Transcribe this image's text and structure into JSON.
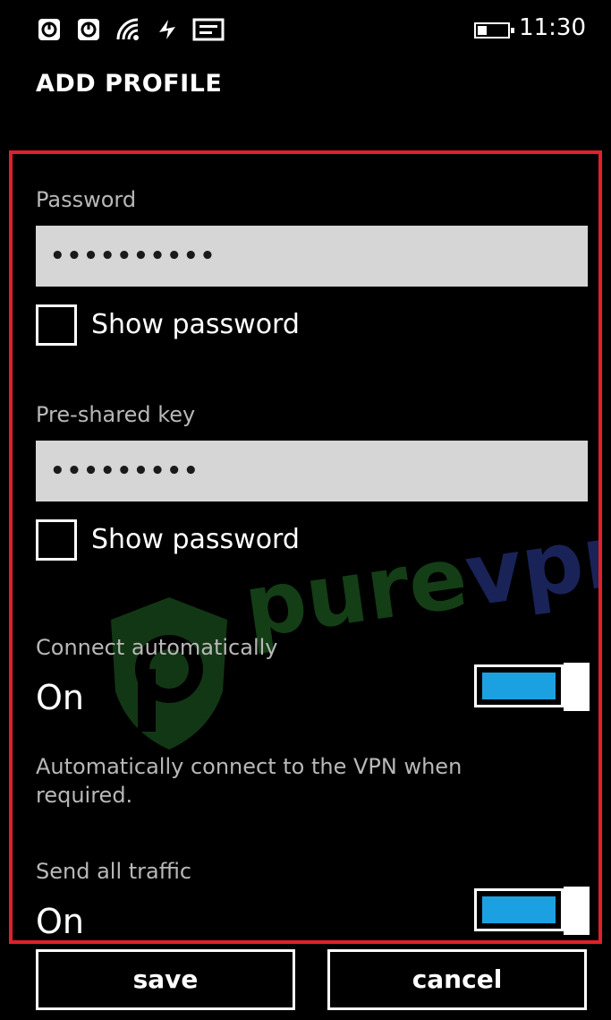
{
  "status_bar": {
    "time": "11:30",
    "icons": [
      "sim-1-icon",
      "sim-2-icon",
      "signal-icon",
      "data-icon",
      "message-icon",
      "battery-icon"
    ]
  },
  "header": {
    "title": "ADD PROFILE"
  },
  "form": {
    "password": {
      "label": "Password",
      "value": "••••••••••"
    },
    "password_show": {
      "label": "Show password",
      "checked": false
    },
    "psk": {
      "label": "Pre-shared key",
      "value": "•••••••••"
    },
    "psk_show": {
      "label": "Show password",
      "checked": false
    },
    "connect_auto": {
      "label": "Connect automatically",
      "state": "On",
      "description": "Automatically connect to the VPN when required."
    },
    "send_all": {
      "label": "Send all traffic",
      "state": "On"
    }
  },
  "watermark": {
    "pure": "pure",
    "vpn": "vpn"
  },
  "app_bar": {
    "save_label": "save",
    "cancel_label": "cancel"
  },
  "colors": {
    "accent": "#1ba1e2",
    "highlight": "#e0202a",
    "field_bg": "#d6d6d6",
    "label": "#b8b8b8"
  }
}
